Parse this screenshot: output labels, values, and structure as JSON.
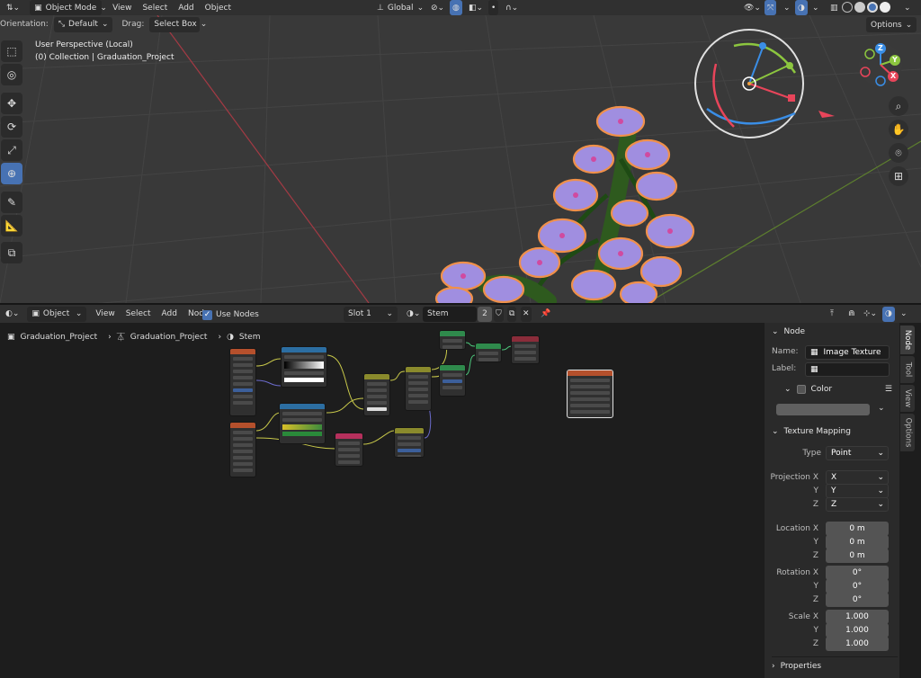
{
  "topbar": {
    "mode": "Object Mode",
    "menus": [
      "View",
      "Select",
      "Add",
      "Object"
    ],
    "transform_orientation": "Global",
    "orientation_label": "Orientation:",
    "orientation_value": "Default",
    "drag_label": "Drag:",
    "drag_value": "Select Box",
    "options": "Options"
  },
  "viewport": {
    "perspective": "User Perspective (Local)",
    "collection": "(0) Collection | Graduation_Project",
    "gizmo_axes": [
      "X",
      "Y",
      "Z"
    ]
  },
  "node_editor": {
    "header": {
      "editor_type": "Object",
      "menus": [
        "View",
        "Select",
        "Add",
        "Node"
      ],
      "use_nodes": "Use Nodes",
      "slot": "Slot 1",
      "material": "Stem",
      "users": "2"
    },
    "breadcrumb": [
      "Graduation_Project",
      "Graduation_Project",
      "Stem"
    ]
  },
  "sidebar": {
    "tabs": [
      "Node",
      "Tool",
      "View",
      "Options"
    ],
    "node_section": "Node",
    "name_label": "Name:",
    "name_value": "Image Texture",
    "label_label": "Label:",
    "label_value": "",
    "color_label": "Color",
    "texture_mapping": "Texture Mapping",
    "type_label": "Type",
    "type_value": "Point",
    "projection_label": "Projection X",
    "projection": {
      "x": "X",
      "y": "Y",
      "z": "Z"
    },
    "location_label": "Location X",
    "location": {
      "x": "0 m",
      "y": "0 m",
      "z": "0 m"
    },
    "rotation_label": "Rotation X",
    "rotation": {
      "x": "0°",
      "y": "0°",
      "z": "0°"
    },
    "scale_label": "Scale X",
    "scale": {
      "x": "1.000",
      "y": "1.000",
      "z": "1.000"
    },
    "axis_y": "Y",
    "axis_z": "Z",
    "properties": "Properties"
  },
  "colors": {
    "accent": "#4772b3",
    "flower": "#a08ee0",
    "outline": "#f0904a",
    "axis_x": "#e8455a",
    "axis_y": "#8cc63f",
    "axis_z": "#3a8ee6"
  }
}
